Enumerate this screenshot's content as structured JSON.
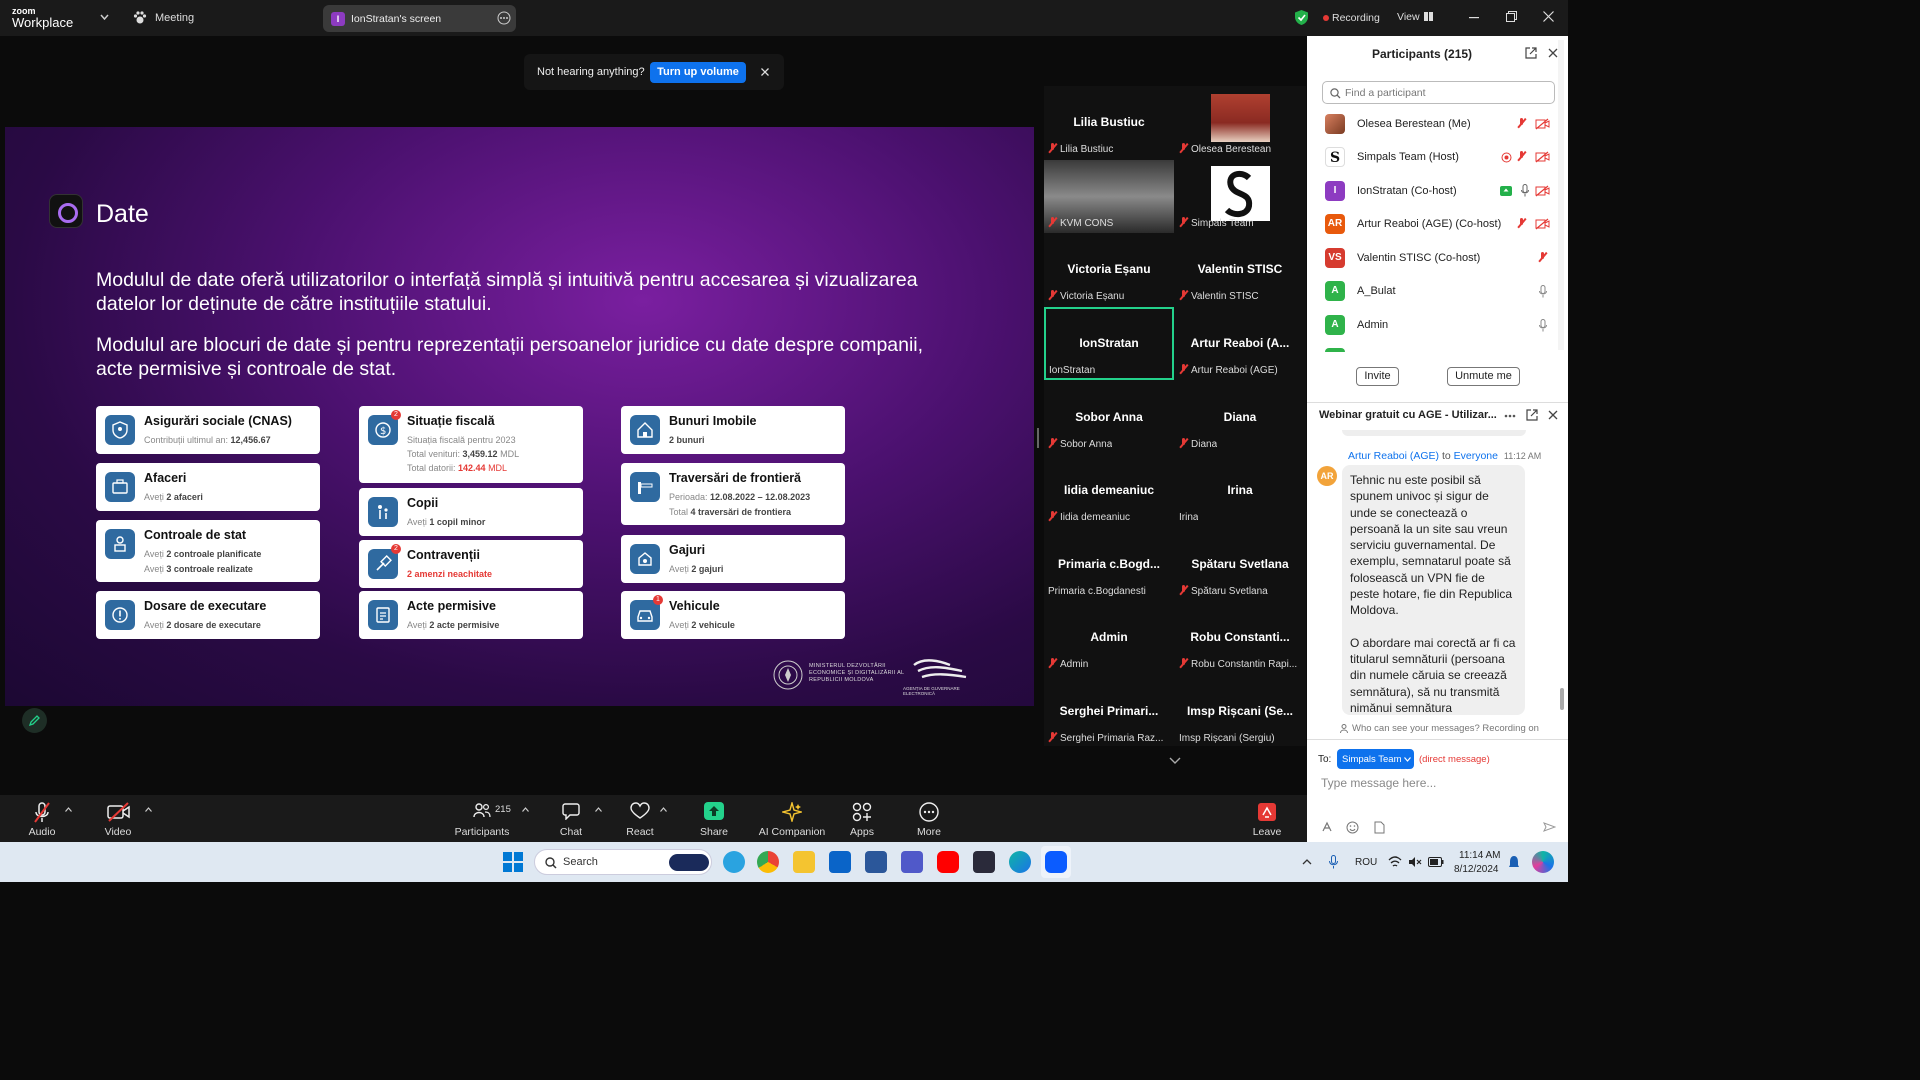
{
  "app": {
    "brand_line1": "zoom",
    "brand_line2": "Workplace",
    "meeting_label": "Meeting",
    "share_badge": "I",
    "share_tab": "IonStratan's screen",
    "recording": "Recording",
    "view": "View"
  },
  "notice": {
    "text": "Not hearing anything?",
    "button": "Turn up volume"
  },
  "slide": {
    "title": "Date",
    "p1": "Modulul de date oferă utilizatorilor o interfață simplă și intuitivă pentru accesarea și vizualizarea datelor lor deținute de către instituțiile statului.",
    "p2": "Modulul are blocuri de date și pentru reprezentații persoanelor juridice cu date despre companii, acte permisive și controale de stat.",
    "cards": {
      "c1": {
        "title": "Asigurări sociale (CNAS)",
        "l1a": "Contribuții ultimul an: ",
        "l1b": "12,456.67"
      },
      "c2": {
        "title": "Afaceri",
        "l1a": "Aveți ",
        "l1b": "2 afaceri"
      },
      "c3": {
        "title": "Controale de stat",
        "l1a": "Aveți ",
        "l1b": "2 controale planificate",
        "l2a": "Aveți ",
        "l2b": "3 controale realizate"
      },
      "c4": {
        "title": "Dosare de executare",
        "l1a": "Aveți ",
        "l1b": "2 dosare de executare"
      },
      "c5": {
        "badge": "2",
        "title": "Situație fiscală",
        "l1": "Situația fiscală pentru 2023",
        "l2a": "Total venituri: ",
        "l2b": "3,459.12",
        "l2c": " MDL",
        "l3a": "Total datorii: ",
        "l3b": "142.44",
        "l3c": " MDL"
      },
      "c6": {
        "title": "Copii",
        "l1a": "Aveți ",
        "l1b": "1 copil minor"
      },
      "c7": {
        "badge": "2",
        "title": "Contravenții",
        "l1": "2 amenzi neachitate"
      },
      "c8": {
        "title": "Acte permisive",
        "l1a": "Aveți ",
        "l1b": "2 acte permisive"
      },
      "c9": {
        "title": "Bunuri Imobile",
        "l1": "2 bunuri"
      },
      "c10": {
        "title": "Traversări de frontieră",
        "l1a": "Perioada: ",
        "l1b": "12.08.2022 – 12.08.2023",
        "l2a": "Total ",
        "l2b": "4 traversări de frontiera"
      },
      "c11": {
        "title": "Gajuri",
        "l1a": "Aveți ",
        "l1b": "2 gajuri"
      },
      "c12": {
        "badge": "1",
        "title": "Vehicule",
        "l1a": "Aveți ",
        "l1b": "2 vehicule"
      }
    },
    "footer_ministry": "MINISTERUL DEZVOLTĂRII ECONOMICE ȘI DIGITALIZĂRII AL REPUBLICII MOLDOVA",
    "footer_agency": "AGENȚIA DE GUVERNARE ELECTRONICĂ"
  },
  "gallery": [
    {
      "name": "Lilia Bustiuc",
      "label": "Lilia Bustiuc"
    },
    {
      "name": "",
      "label": "Olesea Berestean"
    },
    {
      "name": "",
      "label": "KVM CONS"
    },
    {
      "name": "",
      "label": "Simpals Team"
    },
    {
      "name": "Victoria Eșanu",
      "label": "Victoria Eșanu"
    },
    {
      "name": "Valentin STISC",
      "label": "Valentin STISC"
    },
    {
      "name": "IonStratan",
      "label": "IonStratan"
    },
    {
      "name": "Artur Reaboi (A...",
      "label": "Artur Reaboi (AGE)"
    },
    {
      "name": "Sobor Anna",
      "label": "Sobor Anna"
    },
    {
      "name": "Diana",
      "label": "Diana"
    },
    {
      "name": "Iidia demeaniuc",
      "label": "Iidia demeaniuc"
    },
    {
      "name": "Irina",
      "label": "Irina"
    },
    {
      "name": "Primaria c.Bogd...",
      "label": "Primaria c.Bogdanesti"
    },
    {
      "name": "Spătaru Svetlana",
      "label": "Spătaru Svetlana"
    },
    {
      "name": "Admin",
      "label": "Admin"
    },
    {
      "name": "Robu Constanti...",
      "label": "Robu Constantin Rapi..."
    },
    {
      "name": "Serghei Primari...",
      "label": "Serghei Primaria Raz..."
    },
    {
      "name": "Imsp Rișcani (Se...",
      "label": "Imsp Rișcani (Sergiu)"
    }
  ],
  "participants": {
    "title": "Participants (215)",
    "search_placeholder": "Find a participant",
    "list": [
      {
        "initials": "",
        "name": "Olesea Berestean (Me)",
        "color": "#a0522d"
      },
      {
        "initials": "S",
        "name": "Simpals Team (Host)",
        "color": "#ffffff"
      },
      {
        "initials": "I",
        "name": "IonStratan (Co-host)",
        "color": "#8d3bc1"
      },
      {
        "initials": "AR",
        "name": "Artur Reaboi (AGE) (Co-host)",
        "color": "#e8590c"
      },
      {
        "initials": "VS",
        "name": "Valentin STISC (Co-host)",
        "color": "#d63b2f"
      },
      {
        "initials": "A",
        "name": "A_Bulat",
        "color": "#2fb34a"
      },
      {
        "initials": "A",
        "name": "Admin",
        "color": "#2fb34a"
      }
    ],
    "invite": "Invite",
    "unmute": "Unmute me"
  },
  "chat": {
    "title": "Webinar gratuit cu AGE - Utilizar...",
    "sender_initials": "AR",
    "sender": "Artur Reaboi (AGE)",
    "to_word": " to ",
    "recipient": "Everyone",
    "time": "11:12 AM",
    "msg1": "Tehnic nu este posibil să spunem univoc și sigur de unde se conectează o persoană la un site sau vreun serviciu guvernamental. De exemplu, semnatarul poate să folosească un VPN fie de peste hotare, fie din Republica Moldova.",
    "msg2": "O abordare mai corectă ar fi ca titularul semnăturii (persoana din numele căruia se creează semnătura), să nu transmită nimănui semnătura",
    "visibility": "Who can see your messages? Recording on",
    "to_label": "To:",
    "to_value": "Simpals Team",
    "direct": "(direct message)",
    "input_placeholder": "Type message here..."
  },
  "toolbar": {
    "audio": "Audio",
    "video": "Video",
    "participants": "Participants",
    "participants_count": "215",
    "chat": "Chat",
    "react": "React",
    "share": "Share",
    "ai": "AI Companion",
    "apps": "Apps",
    "more": "More",
    "leave": "Leave"
  },
  "taskbar": {
    "search": "Search",
    "lang": "ROU",
    "time": "11:14 AM",
    "date": "8/12/2024"
  },
  "colors": {
    "zoom_blue": "#0e72ed",
    "accent_green": "#23d18b",
    "mute_red": "#e53935"
  }
}
